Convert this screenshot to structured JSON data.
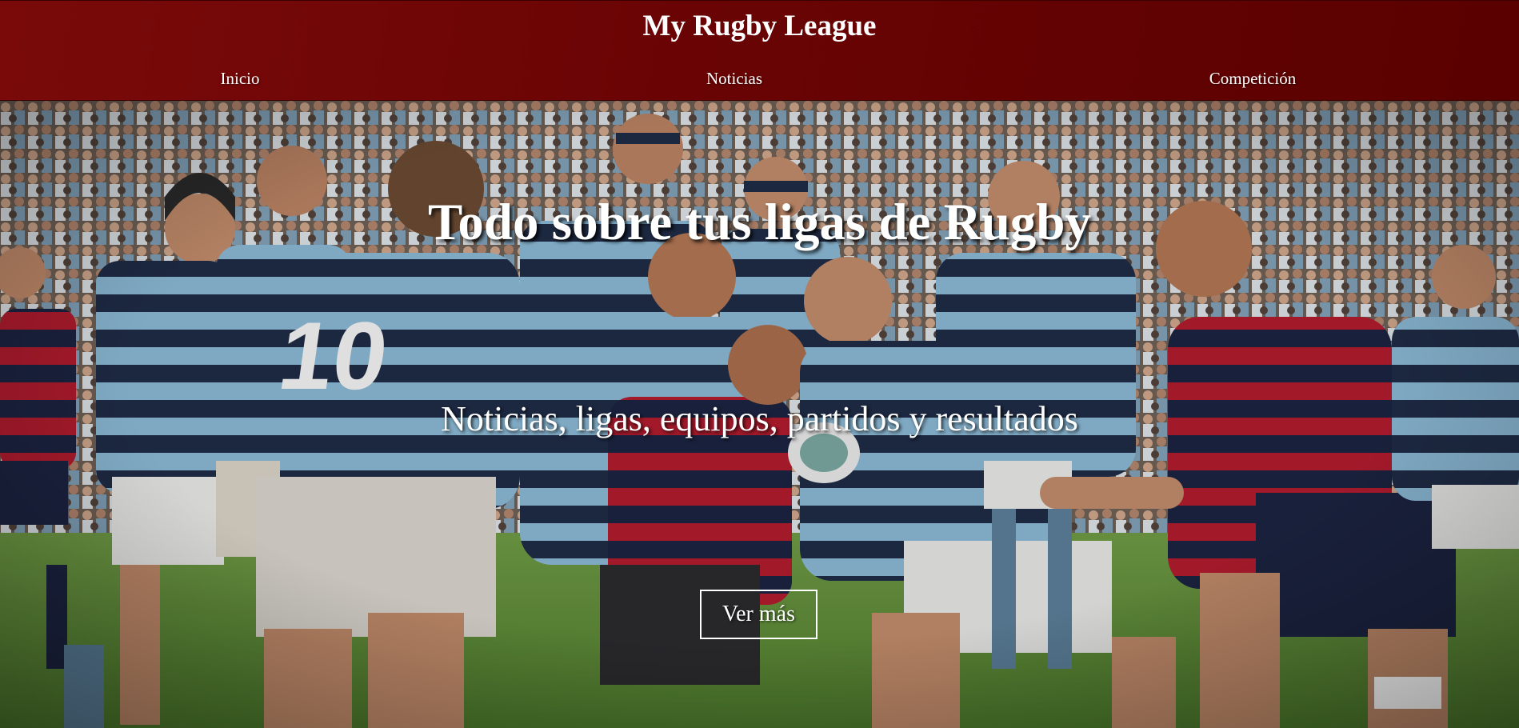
{
  "site": {
    "title": "My Rugby League"
  },
  "nav": {
    "items": [
      {
        "label": "Inicio"
      },
      {
        "label": "Noticias"
      },
      {
        "label": "Competición"
      }
    ]
  },
  "hero": {
    "title": "Todo sobre tus ligas de Rugby",
    "subtitle": "Noticias, ligas, equipos, partidos y resultados",
    "button_label": "Ver más",
    "background_image": "rugby-match-photo"
  },
  "colors": {
    "header_bg": "#6a0404",
    "text": "#ffffff",
    "jersey_blue": "#8ab4cf",
    "jersey_navy": "#1f2c46",
    "jersey_red": "#b01c2e",
    "grass": "#5f8a3a"
  }
}
